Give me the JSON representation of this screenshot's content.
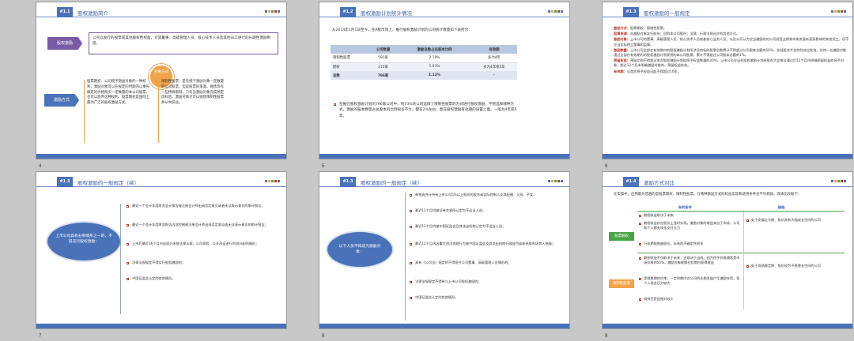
{
  "page_numbers": [
    "4",
    "5",
    "6",
    "7",
    "8",
    "9"
  ],
  "colors": {
    "accent": "#4a72b8",
    "red": "#c0392b",
    "orange": "#f2a24a",
    "purple": "#7a5aa6",
    "green": "#4aa546"
  },
  "slide4": {
    "sec": "#1.1",
    "title": "股权激励简介",
    "tag1": "股权激励",
    "def": "公司以发行的股票或其他股权性权益，对其董事、高级管理人员、核心技术人员及其他员工进行的长期性激励制度。",
    "circle": "主要方式",
    "tag2": "激励方式",
    "left_text": "股票期权：公司授予激励对象的一种权利，激励对象可以在规定的时期内以事先确定的价格购买一定数量的本公司股票，也可以放弃这种权利。股票期权是国际上最为广泛的股权激励方式。",
    "right_text": "限制性股票：是先授予激励对象一定数量的公司股票，但是股票的来源、抛售等有一些特殊限制，只有当激励对象完成预定目标后，激励对象才可以抛售限制性股票并从中获益。"
  },
  "slide5": {
    "sec": "#1.2",
    "title": "股权激励计划统计情况",
    "intro": "从2014年1月1日至今，在A股市场上，推行股权激励计划的公司统计数量如下表所示：",
    "headers": [
      "",
      "公司数量",
      "激励总数占总股本比例",
      "有效期"
    ],
    "rows": [
      [
        "限制性股票",
        "581家",
        "2.19%",
        "多为4年"
      ],
      [
        "期权",
        "215家",
        "1.93%",
        "多为4年或5年"
      ],
      [
        "总数",
        "796家",
        "2.12%",
        "-"
      ]
    ],
    "note": "在推行股权激励计划的796家公司中，有73%的公司选择了限制性股票的方式进行股权激励，不管选择哪种方式，激励的股本数量占总股本的比例很多不大，都在2%左右；而在股权激励有效期的设置上面，一般为4年或5年。"
  },
  "slide6": {
    "sec": "#1.3",
    "title": "股权激励的一般规定",
    "items": [
      {
        "k": "激励方式：",
        "v": "股票期权、限制性股票。"
      },
      {
        "k": "股票来源：",
        "v": "向激励对象发行股份；回购本公司股份；法律、行政法规允许的其他方式。"
      },
      {
        "k": "激励对象：",
        "v": "上市公司的董事、高级管理人员、核心技术人员或者核心业务人员，以及公司认为应当激励的对公司经营业绩和未来发展有直接影响的其他员工，但不应当包括独立董事和监事。"
      },
      {
        "k": "激励数量：",
        "v": "上市公司全部在有效期内的股权激励计划所涉及的标的股票总数累计不得超过公司股本总额的10%。非经股东大会特别决议批准，任何一名激励对象通过全部在有效期内的股权激励计划获授的本公司股票，累计不得超过公司股本总额的1%。"
      },
      {
        "k": "预留权益：",
        "v": "预留比例不得超过本次股权激励计划拟授予权益数量的20%。上市公司应当在股权激励计划经股东大会审议通过后12个月内明确预留权益的授予对象，超过12个月未明确激励对象的，预留权益失效。"
      },
      {
        "k": "有效期：",
        "v": "从首次授予权益日起不得超过10年。"
      }
    ]
  },
  "slide7": {
    "sec": "#1.3",
    "title": "股权激励的一般规定（续）",
    "bubble": "上市公司具有右侧情形之一的，不得实行股权激励：",
    "items": [
      "最近一个会计年度财务会计报告被注册会计师出具否定意见或者无法表示意见的审计报告；",
      "最近一个会计年度财务报告内部控制被注册会计师出具否定意见或无法表示意见的审计报告；",
      "上市后最近36个月内出现过未按法律法规、公司章程、公开承诺进行利润分配的情形；",
      "法律法规规定不得实行股权激励的；",
      "中国证监会认定的其他情形。"
    ]
  },
  "slide8": {
    "sec": "#1.3",
    "title": "股权激励的一般规定（续）",
    "bubble": "以下人员不得成为激励对象：",
    "items": [
      "单独或合计持有上市公司5%以上股份的股东或实际控制人及其配偶、父母、子女；",
      "最近12个月内被证券交易所认定为不适当人选；",
      "最近12个月内被中国证监会及其派出机构认定为不适当人选；",
      "最近12个月内因重大违法违规行为被中国证监会及其派出机构行政处罚或者采取市场禁入措施；",
      "具有《公司法》规定的不得担任公司董事、高级管理人员情形的；",
      "法律法规规定不得参与上市公司股权激励的；",
      "中国证监会认定的其他情形。"
    ]
  },
  "slide9": {
    "sec": "#1.4",
    "title": "激励方式对比",
    "intro": "在实操中，应用最为普遍的是股票期权、限制性股票。在两种激励方式的权益实现和适用条件也不尽相同，具体比较如下：",
    "col_adv": "有利条件",
    "col_dis": "缺陷",
    "rows": [
      {
        "label": "股票期权",
        "adv": [
          "期权收益取决于未来",
          "期权收益仅在股价上涨时实现，激励对象的收益来自于市场，公司和个人都无现金支付压力",
          "行权期限普遍很长，未来的不确定性很多"
        ],
        "dis": [
          "处于发展壮大期、股价具有大幅成长空间的公司"
        ]
      },
      {
        "label": "限制性股票",
        "adv": [
          "期权收益不仅取决于未来，还取决于当前。因为授予价格通常是市场价格的50%，激励对象能够在短期内获得收益",
          "受限售期的约束，一定时期内对公司的长期发展产生激励作用，但个人现金压力较大",
          "减持后获益相对较少"
        ],
        "dis": [
          "处于成熟稳定期、股价较为平稳增长空间的公司"
        ]
      }
    ]
  }
}
